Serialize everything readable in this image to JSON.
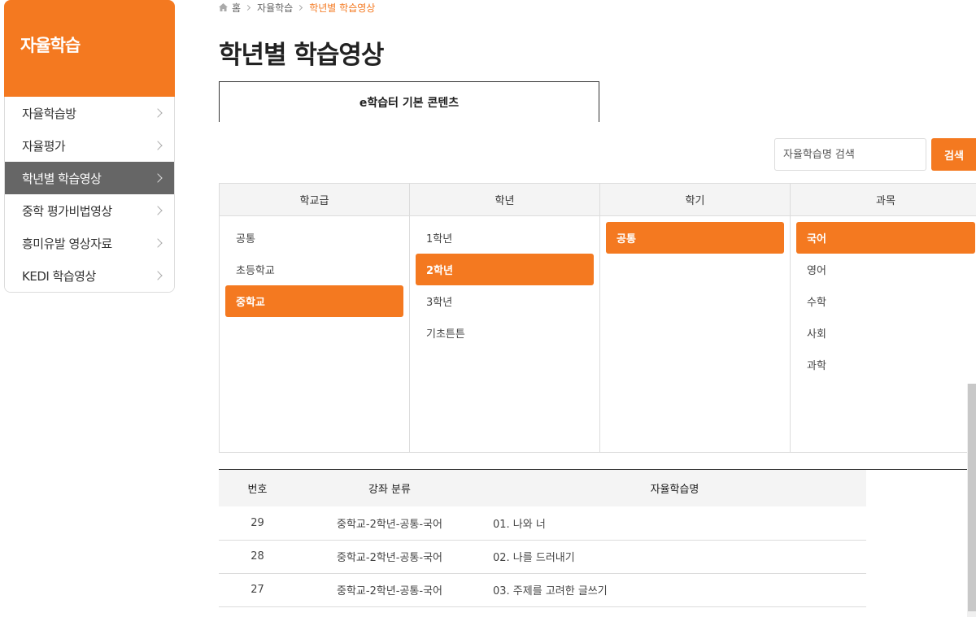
{
  "sidebar": {
    "title": "자율학습",
    "items": [
      {
        "label": "자율학습방",
        "active": false
      },
      {
        "label": "자율평가",
        "active": false
      },
      {
        "label": "학년별 학습영상",
        "active": true
      },
      {
        "label": "중학 평가비법영상",
        "active": false
      },
      {
        "label": "흥미유발 영상자료",
        "active": false
      },
      {
        "label": "KEDI 학습영상",
        "active": false
      }
    ]
  },
  "breadcrumb": {
    "home": "홈",
    "level1": "자율학습",
    "current": "학년별 학습영상"
  },
  "page_title": "학년별 학습영상",
  "tab": {
    "label": "e학습터 기본 콘텐츠"
  },
  "search": {
    "placeholder": "자율학습명 검색",
    "button_label": "검색"
  },
  "filters": {
    "school_level": {
      "header": "학교급",
      "options": [
        "공통",
        "초등학교",
        "중학교"
      ],
      "selected": "중학교"
    },
    "grade": {
      "header": "학년",
      "options": [
        "1학년",
        "2학년",
        "3학년",
        "기초튼튼"
      ],
      "selected": "2학년"
    },
    "semester": {
      "header": "학기",
      "options": [
        "공통"
      ],
      "selected": "공통"
    },
    "subject": {
      "header": "과목",
      "options": [
        "국어",
        "영어",
        "수학",
        "사회",
        "과학"
      ],
      "selected": "국어"
    }
  },
  "results": {
    "headers": {
      "number": "번호",
      "category": "강좌 분류",
      "name": "자율학습명"
    },
    "rows": [
      {
        "number": "29",
        "category": "중학교-2학년-공통-국어",
        "name": "01. 나와 너"
      },
      {
        "number": "28",
        "category": "중학교-2학년-공통-국어",
        "name": "02. 나를 드러내기"
      },
      {
        "number": "27",
        "category": "중학교-2학년-공통-국어",
        "name": "03. 주제를 고려한 글쓰기"
      }
    ]
  },
  "colors": {
    "accent": "#f47920",
    "active_menu": "#666666"
  }
}
